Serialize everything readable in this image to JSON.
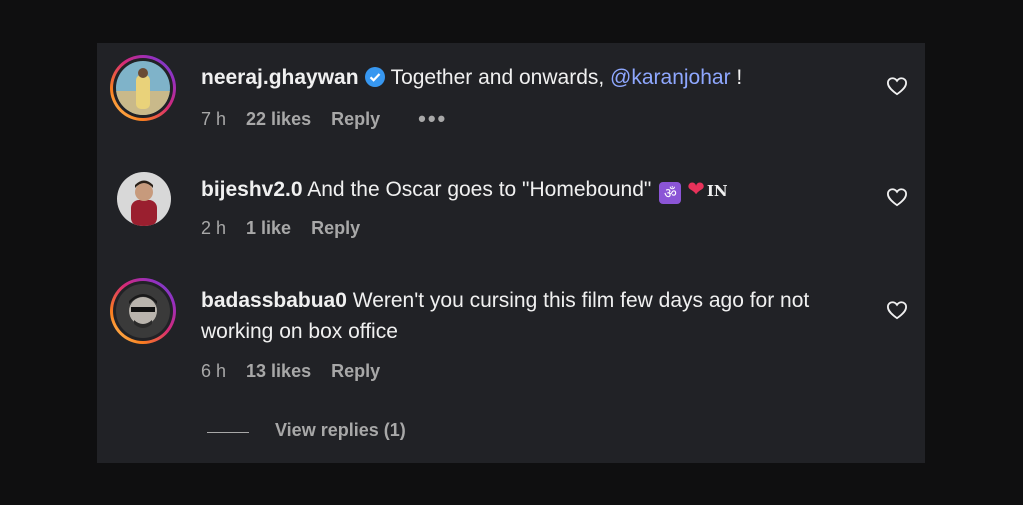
{
  "comments": [
    {
      "username": "neeraj.ghaywan",
      "verified": true,
      "text_before": "Together and onwards, ",
      "mention": "@karanjohar",
      "text_after": " !",
      "time": "7 h",
      "likes": "22 likes",
      "reply": "Reply",
      "more": "•••"
    },
    {
      "username": "bijeshv2.0",
      "text": "And the Oscar goes to \"Homebound\"",
      "emoji_om": "ॐ",
      "emoji_heart": "❤",
      "flag_text": "IN",
      "time": "2 h",
      "likes": "1 like",
      "reply": "Reply"
    },
    {
      "username": "badassbabua0",
      "text": "Weren't you cursing this film few days ago for not working on box office",
      "time": "6 h",
      "likes": "13 likes",
      "reply": "Reply"
    }
  ],
  "view_replies": "View replies (1)",
  "colors": {
    "background": "#0f0f10",
    "panel": "#212226",
    "mention": "#8fa8ff",
    "verified": "#3797f0",
    "meta": "#a8a8a8"
  }
}
